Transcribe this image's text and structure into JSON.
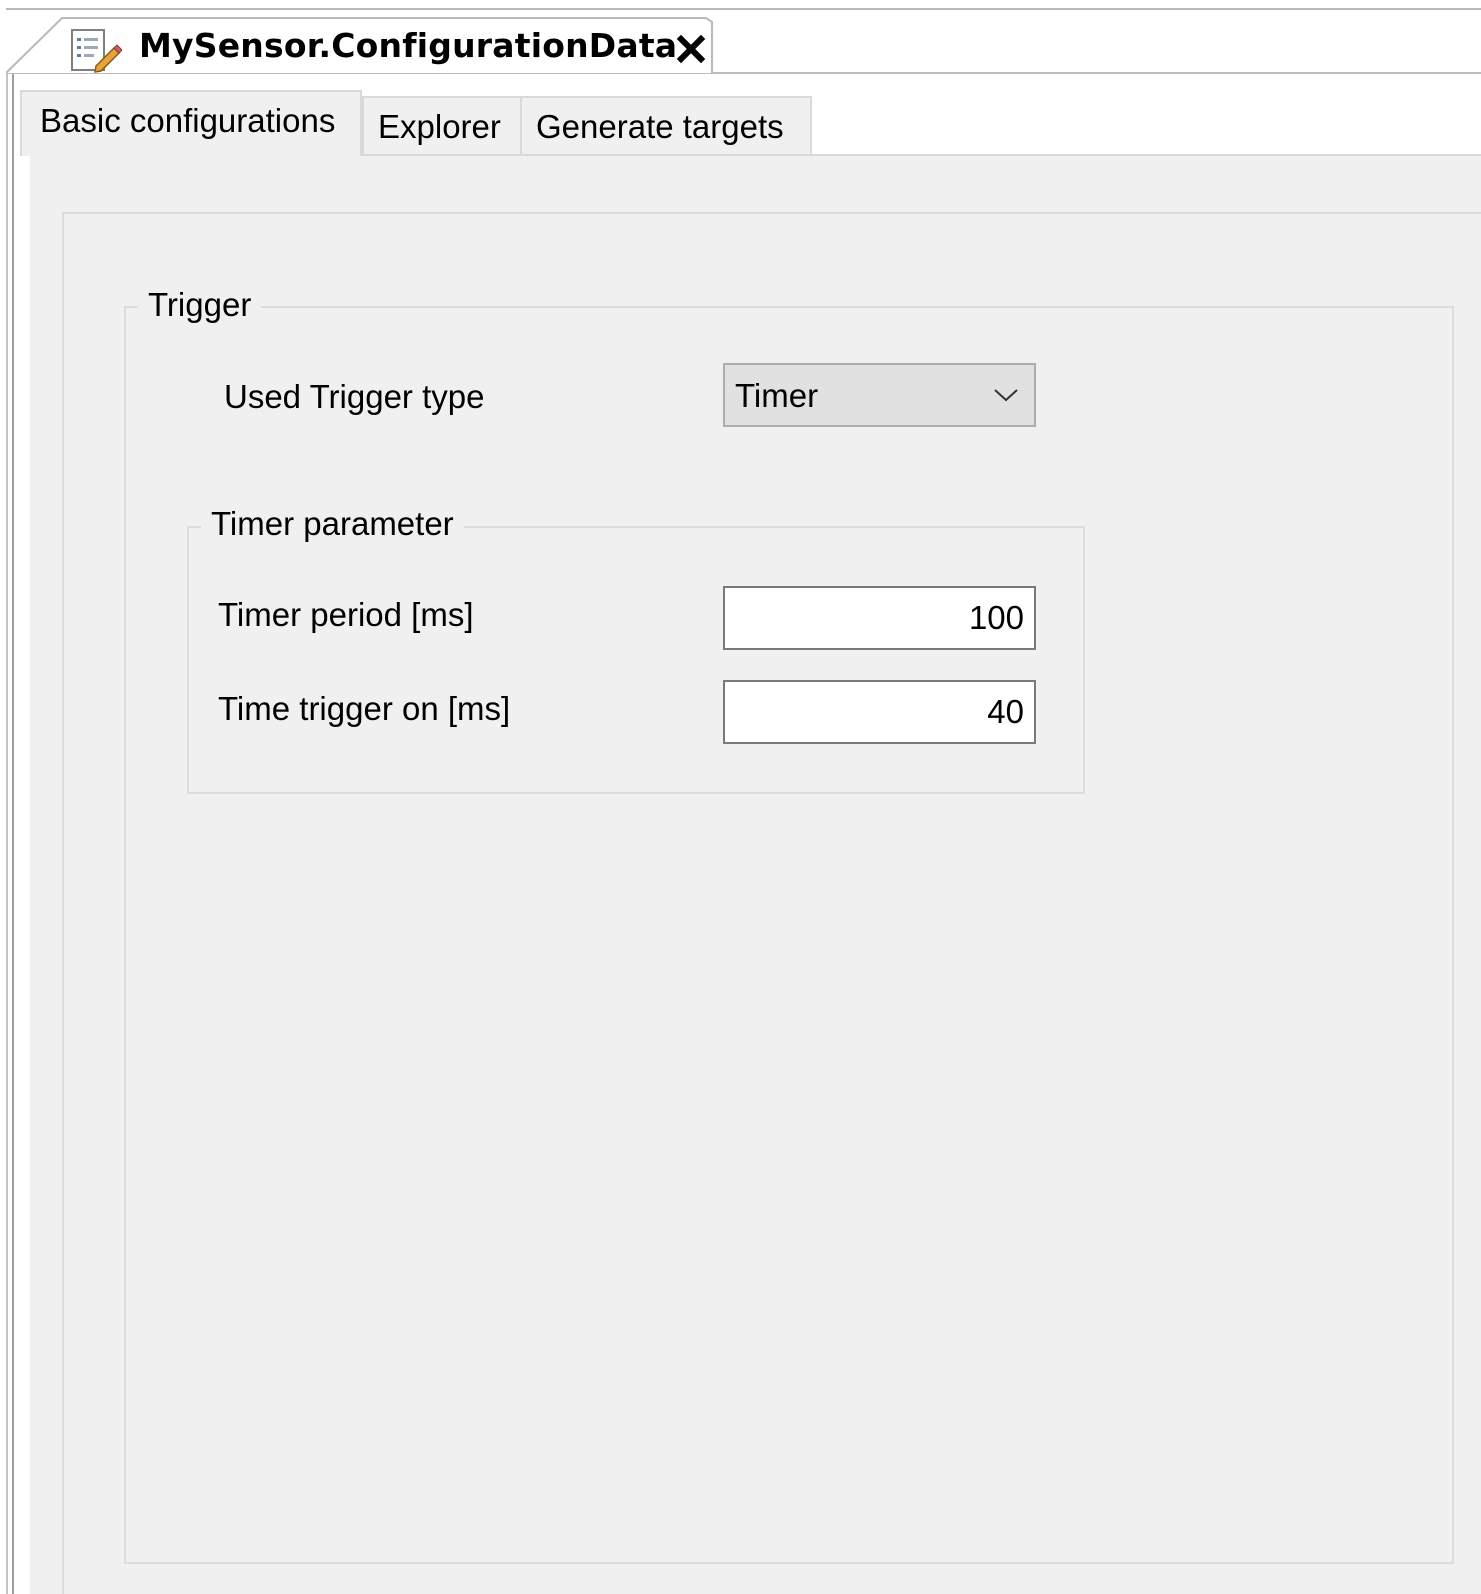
{
  "document_tab": {
    "title": "MySensor.ConfigurationData",
    "icon": "config-document-icon",
    "close_icon": "close-icon"
  },
  "sub_tabs": [
    {
      "label": "Basic configurations",
      "active": true
    },
    {
      "label": "Explorer",
      "active": false
    },
    {
      "label": "Generate targets",
      "active": false
    }
  ],
  "trigger_group": {
    "title": "Trigger",
    "used_trigger_type": {
      "label": "Used Trigger type",
      "selected": "Timer"
    },
    "timer_parameter": {
      "title": "Timer parameter",
      "timer_period": {
        "label": "Timer period [ms]",
        "value": "100"
      },
      "time_trigger_on": {
        "label": "Time trigger on [ms]",
        "value": "40"
      }
    }
  },
  "colors": {
    "panel_background": "#f0f0f0",
    "border": "#dcdcdc",
    "combo_background": "#e1e1e1"
  }
}
